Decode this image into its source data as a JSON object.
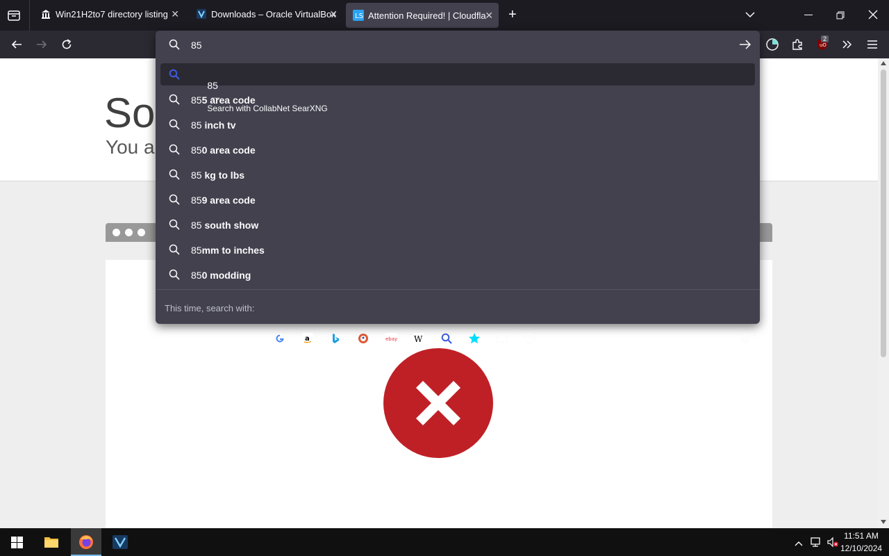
{
  "tabs": [
    {
      "title": "Win21H2to7 directory listing"
    },
    {
      "title": "Downloads – Oracle VirtualBox"
    },
    {
      "title": "Attention Required! | Cloudflare"
    }
  ],
  "page": {
    "heading_partial": "Sor",
    "subheading_partial": "You a"
  },
  "urlbar": {
    "value": "85",
    "heuristic": {
      "query": "85",
      "separator": "—",
      "action": "Search with CollabNet SearXNG"
    },
    "suggestions": [
      {
        "prefix": "85",
        "rest": "5 area code"
      },
      {
        "prefix": "85",
        "rest": " inch tv"
      },
      {
        "prefix": "85",
        "rest": "0 area code"
      },
      {
        "prefix": "85",
        "rest": " kg to lbs"
      },
      {
        "prefix": "85",
        "rest": "9 area code"
      },
      {
        "prefix": "85",
        "rest": " south show"
      },
      {
        "prefix": "85",
        "rest": "mm to inches"
      },
      {
        "prefix": "85",
        "rest": "0 modding"
      }
    ],
    "one_off_label": "This time, search with:",
    "engines": [
      "google-icon",
      "amazon-icon",
      "bing-icon",
      "duckduckgo-icon",
      "ebay-icon",
      "wikipedia-icon",
      "searxng-icon",
      "bookmarks-icon",
      "tabs-icon",
      "history-icon"
    ]
  },
  "toolbar": {
    "ublock_badge": "2"
  },
  "taskbar": {
    "time": "11:51 AM",
    "date": "12/10/2024"
  },
  "colors": {
    "error_red": "#bf2026",
    "accent_blue": "#0060df"
  }
}
